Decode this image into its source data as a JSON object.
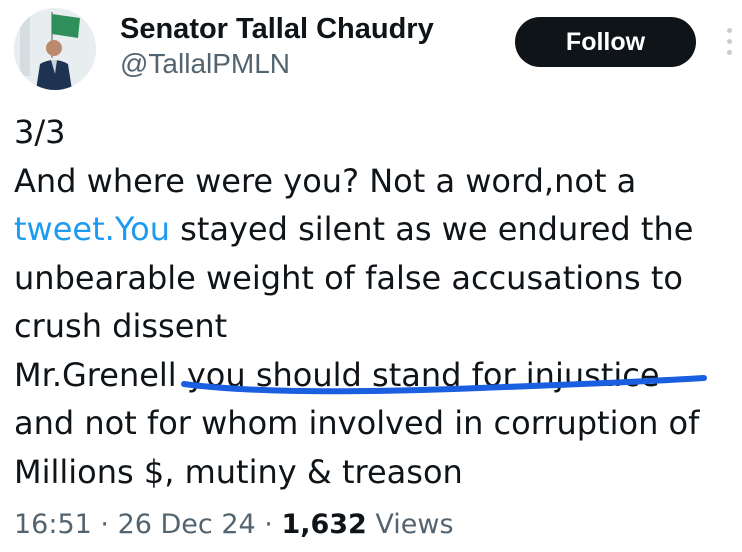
{
  "author": {
    "display_name": "Senator Tallal Chaudry",
    "handle": "@TallalPMLN"
  },
  "follow_button": {
    "label": "Follow"
  },
  "tweet": {
    "lines": {
      "l1": "3/3",
      "l2": "And where were you? Not a word,not a",
      "l3_link": "tweet.You",
      "l3_rest": " stayed silent as we endured the",
      "l4": "unbearable weight of false accusations to",
      "l5": "crush dissent",
      "l6": "Mr.Grenell you should stand for injustice",
      "l7": "and not for whom involved in corruption of",
      "l8": "Millions $, mutiny & treason"
    },
    "link_color": "#1d9bf0",
    "annotation_color": "#1a5fe0"
  },
  "meta": {
    "time": "16:51",
    "separator": " · ",
    "date": "26 Dec 24",
    "views_count": "1,632",
    "views_label": " Views"
  },
  "icons": {
    "more": "more-vertical-icon"
  }
}
